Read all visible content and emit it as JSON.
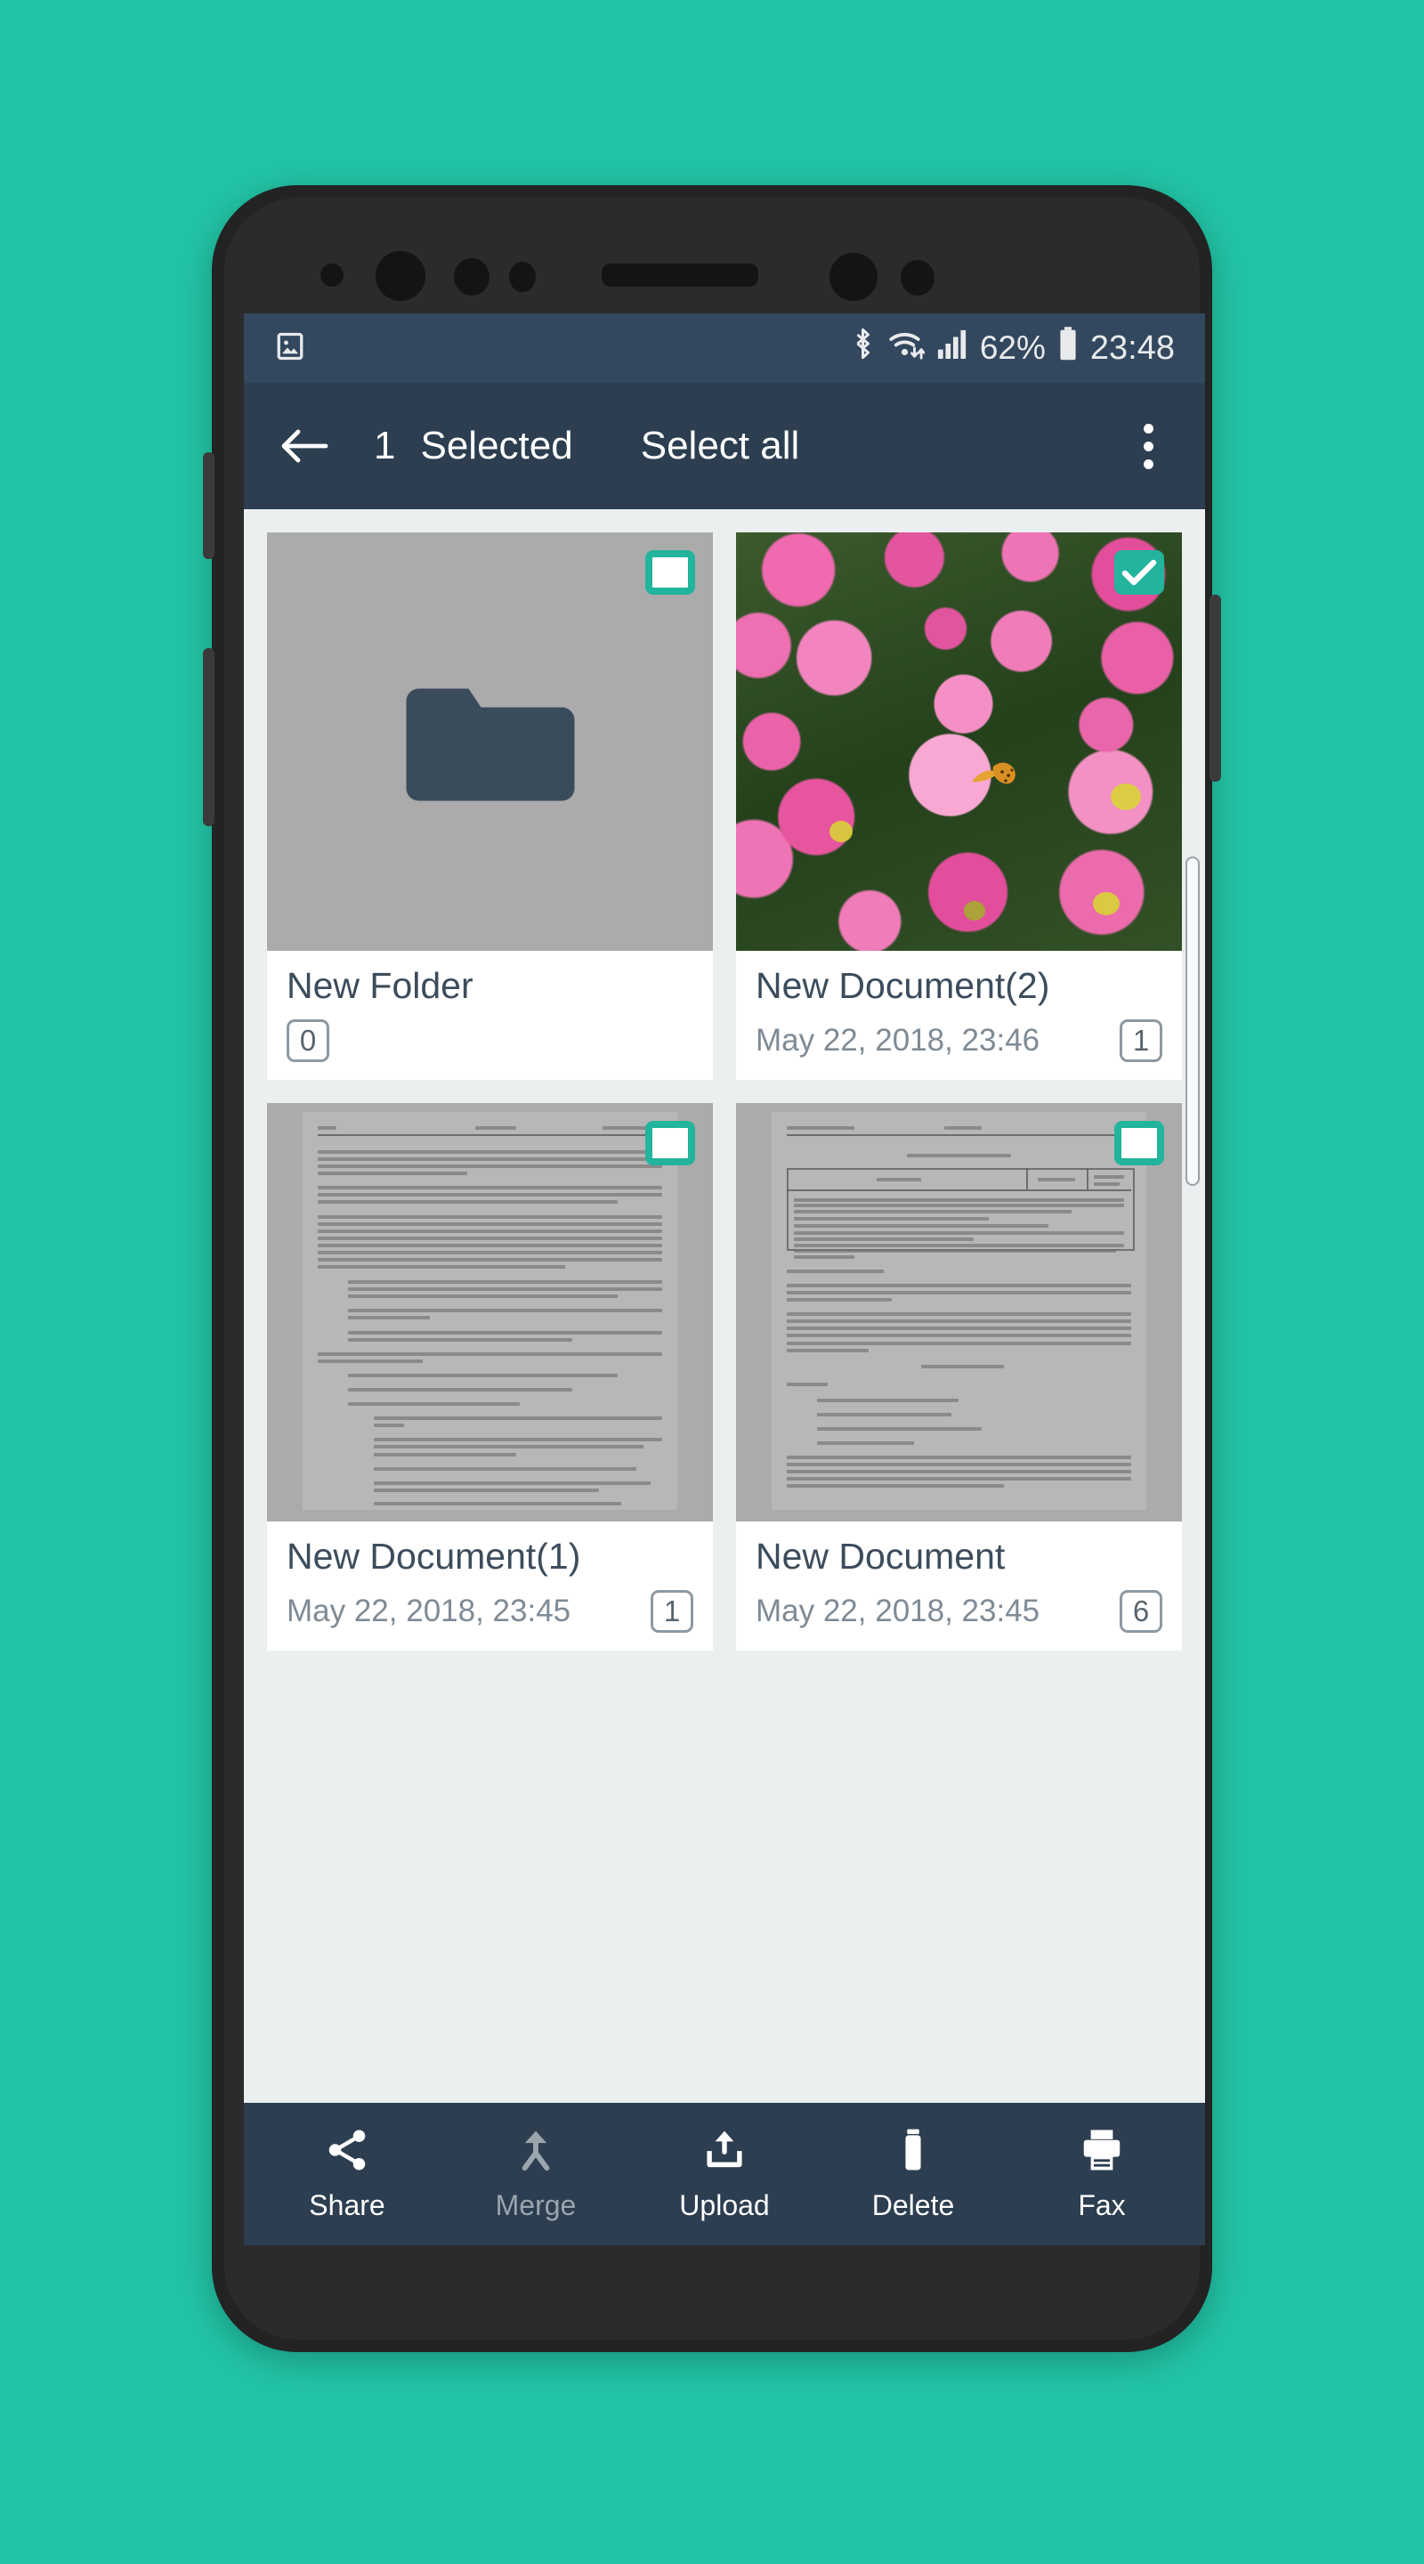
{
  "theme": {
    "background": "#22c4a6",
    "appbar": "#2c3e50",
    "statusbar": "#33485e",
    "accent": "#22b49c",
    "content_bg": "#eceff0",
    "thumb_bg": "#ababab"
  },
  "statusbar": {
    "left_icon": "image-icon",
    "bluetooth_icon": "bluetooth-icon",
    "wifi_icon": "wifi-icon",
    "signal_icon": "cellular-signal-icon",
    "battery_percent": "62%",
    "battery_icon": "battery-icon",
    "clock": "23:48"
  },
  "appbar": {
    "back_icon": "back-arrow-icon",
    "selected_count": "1",
    "selected_label": "Selected",
    "select_all_label": "Select all",
    "overflow_icon": "overflow-menu-icon"
  },
  "grid": {
    "items": [
      {
        "name": "New Folder",
        "type": "folder",
        "icon": "folder-icon",
        "date": "",
        "count": "0",
        "selected": false
      },
      {
        "name": "New Document(2)",
        "type": "image",
        "icon": "photo-thumbnail",
        "date": "May 22, 2018, 23:46",
        "count": "1",
        "selected": true
      },
      {
        "name": "New Document(1)",
        "type": "document",
        "icon": "document-thumbnail",
        "date": "May 22, 2018, 23:45",
        "count": "1",
        "selected": false
      },
      {
        "name": "New Document",
        "type": "document",
        "icon": "document-thumbnail",
        "date": "May 22, 2018, 23:45",
        "count": "6",
        "selected": false
      }
    ]
  },
  "bottombar": {
    "actions": [
      {
        "label": "Share",
        "icon": "share-icon",
        "enabled": true
      },
      {
        "label": "Merge",
        "icon": "merge-icon",
        "enabled": false
      },
      {
        "label": "Upload",
        "icon": "upload-icon",
        "enabled": true
      },
      {
        "label": "Delete",
        "icon": "trash-icon",
        "enabled": true
      },
      {
        "label": "Fax",
        "icon": "printer-icon",
        "enabled": true
      }
    ]
  }
}
